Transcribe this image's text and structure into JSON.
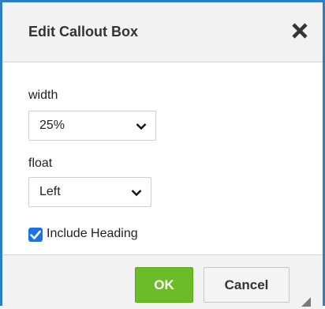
{
  "dialog": {
    "title": "Edit Callout Box",
    "close_icon": "close-icon"
  },
  "fields": {
    "width": {
      "label": "width",
      "selected": "25%"
    },
    "float": {
      "label": "float",
      "selected": "Left"
    },
    "include_heading": {
      "label": "Include Heading",
      "checked": true
    }
  },
  "footer": {
    "ok_label": "OK",
    "cancel_label": "Cancel"
  },
  "colors": {
    "border": "#2c7fc0",
    "ok_button": "#6cbc2a",
    "checkbox": "#1a73e8"
  }
}
